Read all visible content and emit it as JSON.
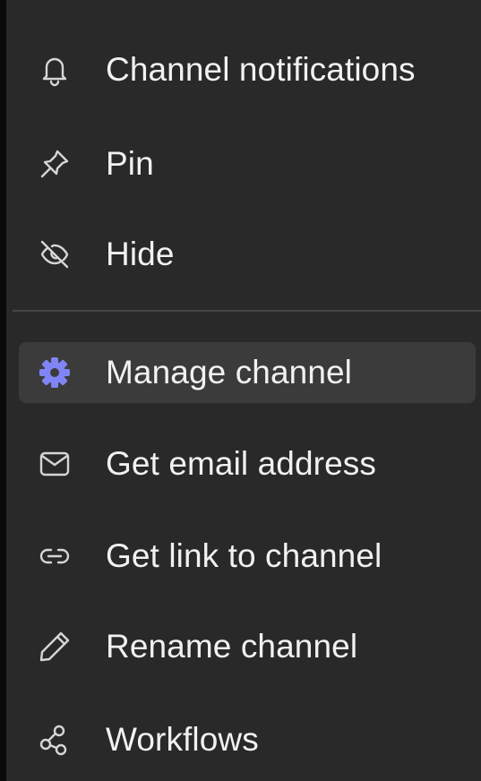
{
  "colors": {
    "menu_background": "#292929",
    "active_background": "#3b3b3b",
    "text": "#f1f1f1",
    "icon": "#d6d6d6",
    "accent_icon": "#7f85f5",
    "divider": "#454545"
  },
  "menu": {
    "items": [
      {
        "label": "Channel notifications",
        "icon": "bell-icon"
      },
      {
        "label": "Pin",
        "icon": "pin-icon"
      },
      {
        "label": "Hide",
        "icon": "eye-off-icon"
      },
      {
        "label": "Manage channel",
        "icon": "gear-icon",
        "active": true
      },
      {
        "label": "Get email address",
        "icon": "mail-icon"
      },
      {
        "label": "Get link to channel",
        "icon": "link-icon"
      },
      {
        "label": "Rename channel",
        "icon": "pencil-icon"
      },
      {
        "label": "Workflows",
        "icon": "workflows-icon"
      }
    ]
  }
}
